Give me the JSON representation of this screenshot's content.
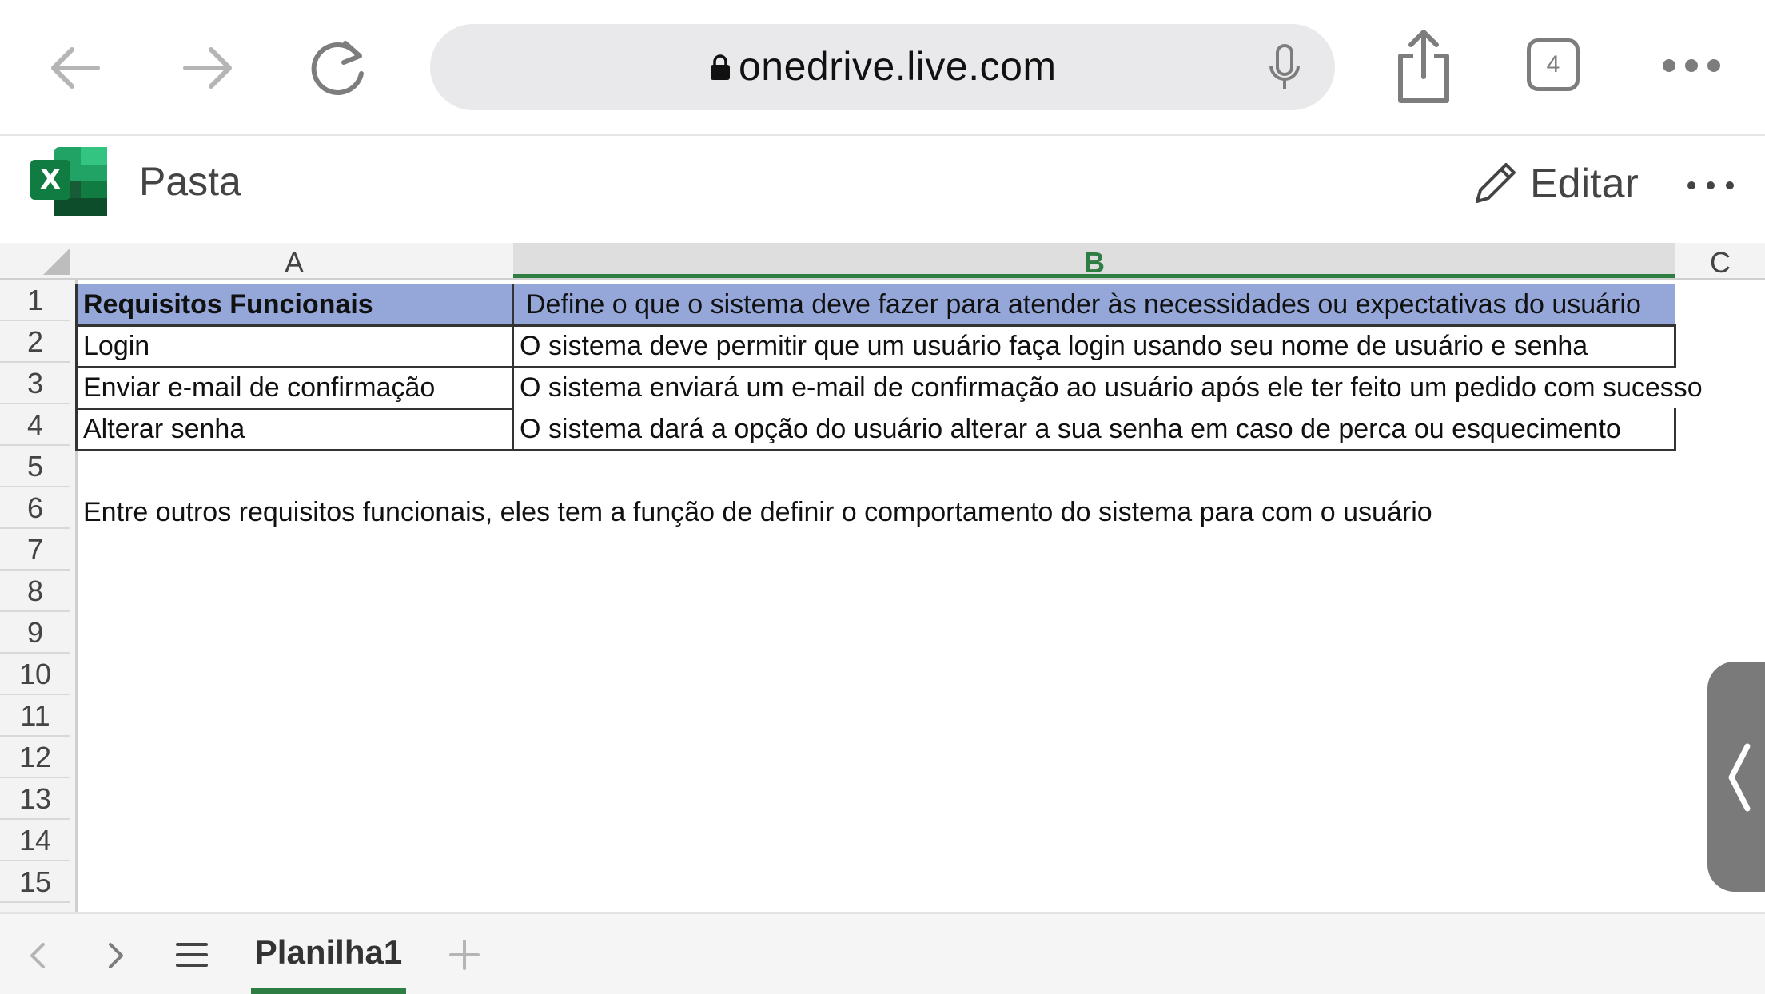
{
  "browser": {
    "url": "onedrive.live.com",
    "tab_count": "4",
    "icons": [
      "back-arrow-icon",
      "forward-arrow-icon",
      "reload-icon",
      "lock-icon",
      "microphone-icon",
      "share-icon",
      "more-icon"
    ]
  },
  "app": {
    "title": "Pasta",
    "edit_label": "Editar",
    "icons": [
      "excel-logo-icon",
      "pencil-icon",
      "more-icon"
    ]
  },
  "sheet": {
    "columns": [
      "A",
      "B",
      "C"
    ],
    "selected_column": "B",
    "rows": [
      "1",
      "2",
      "3",
      "4",
      "5",
      "6",
      "7",
      "8",
      "9",
      "10",
      "11",
      "12",
      "13",
      "14",
      "15"
    ],
    "cells": {
      "a1": "Requisitos Funcionais",
      "b1": "Define o que o sistema deve fazer para atender às necessidades ou expectativas do usuário",
      "a2": "Login",
      "b2": "O sistema deve permitir que um usuário faça login usando seu nome de usuário e senha",
      "a3": "Enviar e-mail de confirmação",
      "b3": "O sistema enviará um e-mail de confirmação ao usuário após ele ter feito um pedido com sucesso",
      "a4": "Alterar senha",
      "b4": "O sistema dará a opção do usuário alterar a sua senha em caso de perca ou esquecimento",
      "a6": "Entre outros requisitos funcionais, eles tem a função de definir o comportamento do sistema para com o usuário"
    },
    "highlight_color": "#94a7d8"
  },
  "sheet_tabs": {
    "active": "Planilha1",
    "accent": "#2e7d42"
  }
}
